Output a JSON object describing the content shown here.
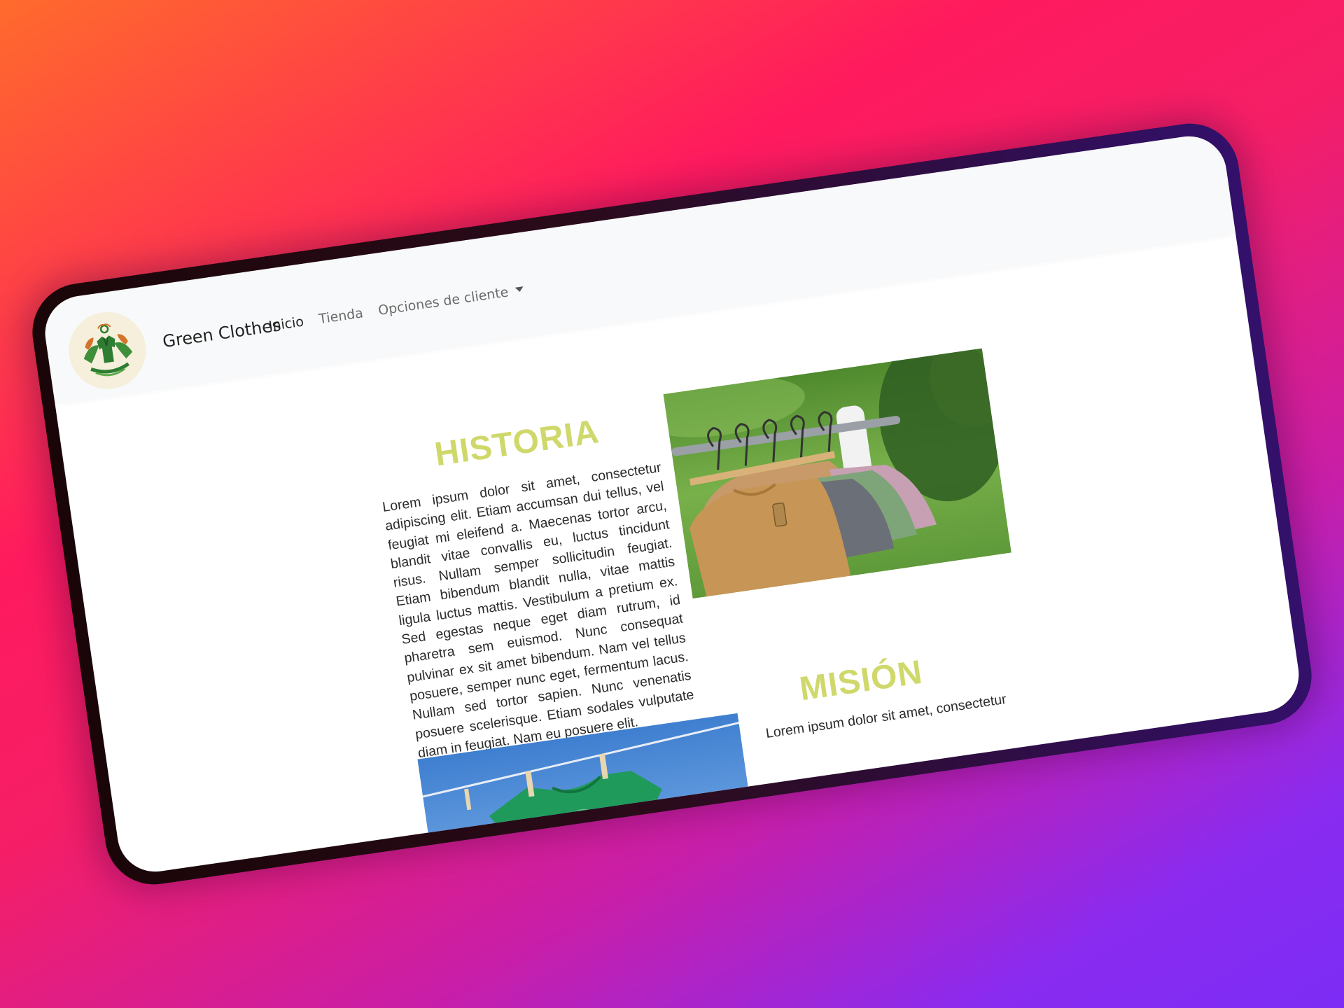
{
  "navbar": {
    "brand": "Green Clothes",
    "logo_icon": "green-clothes-logo-icon",
    "links": [
      {
        "label": "Inicio",
        "active": true
      },
      {
        "label": "Tienda",
        "active": false
      },
      {
        "label": "Opciones de cliente",
        "active": false,
        "dropdown": true
      }
    ]
  },
  "historia": {
    "title": "HISTORIA",
    "text": "Lorem ipsum dolor sit amet, consectetur adipiscing elit. Etiam accumsan dui tellus, vel feugiat mi eleifend a. Maecenas tortor arcu, blandit vitae convallis eu, luctus tincidunt risus. Nullam semper sollicitudin feugiat. Etiam bibendum blandit nulla, vitae mattis ligula luctus mattis. Vestibulum a pretium ex. Sed egestas neque eget diam rutrum, id pharetra sem euismod. Nunc consequat pulvinar ex sit amet bibendum. Nam vel tellus posuere, semper nunc eget, fermentum lacus. Nullam sed tortor sapien. Nunc venenatis posuere scelerisque. Etiam sodales vulputate diam in feugiat. Nam eu posuere elit.",
    "image_icon": "clothes-on-hangers-photo"
  },
  "mision": {
    "title": "MISIÓN",
    "text": "Lorem ipsum dolor sit amet, consectetur",
    "image_icon": "green-shirt-on-clothesline-photo"
  },
  "colors": {
    "accent_title": "#cfd86a",
    "navbar_bg": "#f8f9fa",
    "text": "#2b2b2b"
  }
}
